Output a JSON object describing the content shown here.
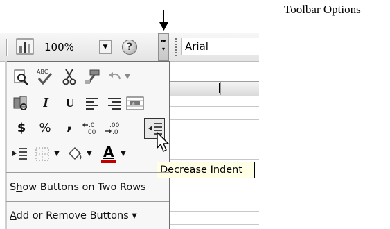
{
  "callout": {
    "label": "Toolbar Options"
  },
  "toolbar": {
    "zoom_value": "100%",
    "font_value": "Arial",
    "icons": [
      "chart-wizard-icon",
      "help-icon",
      "toolbar-options-icon"
    ]
  },
  "panel": {
    "rows": [
      [
        "print-preview-icon",
        "spelling-icon",
        "cut-icon",
        "format-painter-icon",
        "undo-icon",
        "dropdown-arrow-icon"
      ],
      [
        "research-icon",
        "italic-icon",
        "underline-icon",
        "align-left-icon",
        "align-right-icon",
        "merge-center-icon"
      ],
      [
        "currency-icon",
        "percent-icon",
        "comma-icon",
        "increase-decimal-icon",
        "decrease-decimal-icon",
        "decrease-indent-icon"
      ],
      [
        "increase-indent-icon",
        "borders-icon",
        "fill-color-icon",
        "font-color-icon"
      ]
    ],
    "glyphs": {
      "italic": "I",
      "underline": "U",
      "currency": "$",
      "percent": "%",
      "comma": ",",
      "font_color": "A",
      "help": "?"
    },
    "show_two_rows": {
      "prefix": "S",
      "accel": "h",
      "rest": "ow Buttons on Two Rows"
    },
    "add_remove": {
      "accel": "A",
      "rest": "dd or Remove Buttons",
      "arrow": "▾"
    }
  },
  "tooltip": {
    "text": "Decrease Indent"
  },
  "colors": {
    "tooltip_bg": "#ffffe6",
    "panel_bg": "#f7f7f7",
    "font_color_bar": "#c00000"
  }
}
